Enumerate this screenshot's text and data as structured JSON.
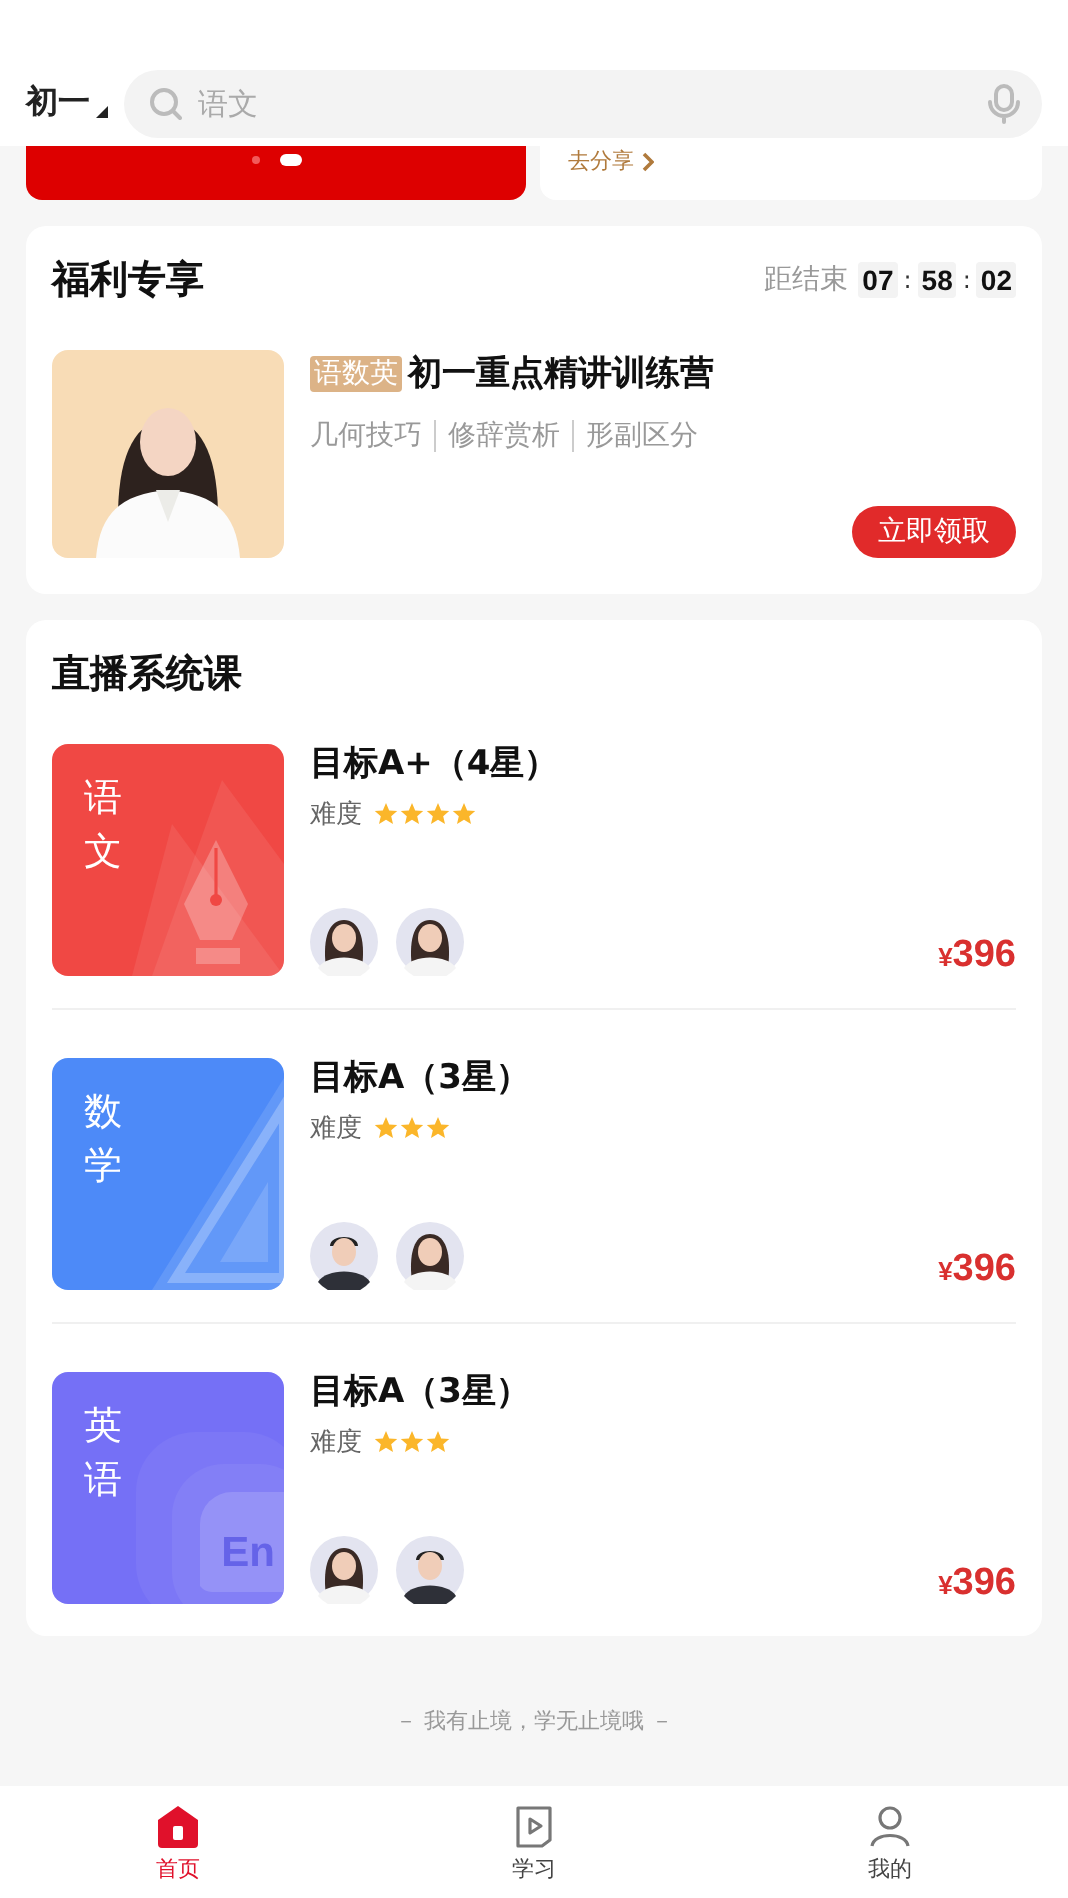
{
  "header": {
    "grade": "初一",
    "search": {
      "placeholder": "语文"
    }
  },
  "banner": {
    "pager": [
      {
        "selected": false
      },
      {
        "selected": true
      }
    ],
    "share_link": "去分享"
  },
  "welfare": {
    "title": "福利专享",
    "countdown": {
      "label": "距结束",
      "hours": "07",
      "minutes": "58",
      "seconds": "02",
      "separator": ":"
    },
    "offer": {
      "tag": "语数英",
      "title": "初一重点精讲训练营",
      "topics": [
        "几何技巧",
        "修辞赏析",
        "形副区分"
      ],
      "button": "立即领取"
    }
  },
  "courses": {
    "title": "直播系统课",
    "items": [
      {
        "subject": "语文",
        "kind": "pen",
        "color": "#f04844",
        "title": "目标A+（4星）",
        "difficulty_label": "难度",
        "stars": 4,
        "teachers": [
          {
            "kind": "woman"
          },
          {
            "kind": "woman"
          }
        ],
        "currency": "¥",
        "price": "396"
      },
      {
        "subject": "数学",
        "kind": "ruler",
        "color": "#4d8af8",
        "title": "目标A（3星）",
        "difficulty_label": "难度",
        "stars": 3,
        "teachers": [
          {
            "kind": "man"
          },
          {
            "kind": "woman"
          }
        ],
        "currency": "¥",
        "price": "396"
      },
      {
        "subject": "英语",
        "kind": "bubble",
        "emblem_text": "En",
        "color": "#7570f6",
        "title": "目标A（3星）",
        "difficulty_label": "难度",
        "stars": 3,
        "teachers": [
          {
            "kind": "woman"
          },
          {
            "kind": "man"
          }
        ],
        "currency": "¥",
        "price": "396"
      }
    ]
  },
  "slogan": "－ 我有止境，学无止境哦 －",
  "tabbar": [
    {
      "label": "首页",
      "kind": "home",
      "selected": true
    },
    {
      "label": "学习",
      "kind": "play",
      "selected": false
    },
    {
      "label": "我的",
      "kind": "person",
      "selected": false
    }
  ]
}
